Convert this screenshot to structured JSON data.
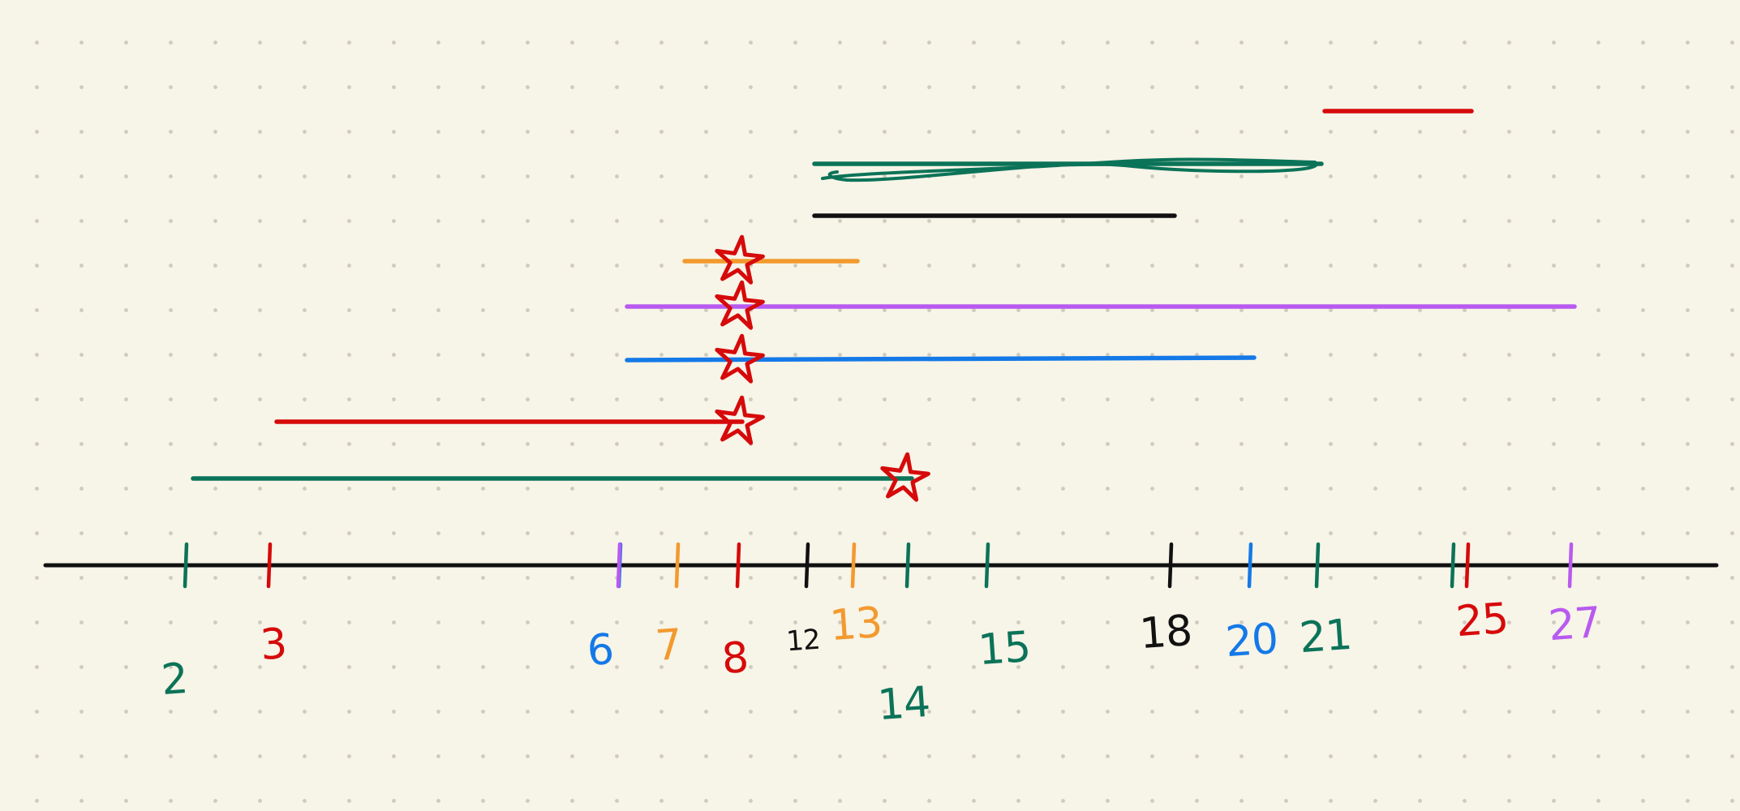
{
  "palette": {
    "green": "#0b7358",
    "red": "#d60a0a",
    "purple": "#b85af0",
    "orange": "#f29a2e",
    "blue": "#1479e8",
    "black": "#111111",
    "background": "#f7f4e8"
  },
  "number_line": {
    "ticks": [
      {
        "value": 2,
        "label": "2",
        "color": "green"
      },
      {
        "value": 3,
        "label": "3",
        "color": "red"
      },
      {
        "value": 6,
        "label": "6",
        "color": "blue"
      },
      {
        "value": 6,
        "label": "",
        "color": "purple"
      },
      {
        "value": 7,
        "label": "7",
        "color": "orange"
      },
      {
        "value": 8,
        "label": "8",
        "color": "red"
      },
      {
        "value": 12,
        "label": "12",
        "color": "black"
      },
      {
        "value": 13,
        "label": "13",
        "color": "orange"
      },
      {
        "value": 14,
        "label": "14",
        "color": "green"
      },
      {
        "value": 15,
        "label": "15",
        "color": "green"
      },
      {
        "value": 18,
        "label": "18",
        "color": "black"
      },
      {
        "value": 20,
        "label": "20",
        "color": "blue"
      },
      {
        "value": 21,
        "label": "21",
        "color": "green"
      },
      {
        "value": 25,
        "label": "25",
        "color": "red"
      },
      {
        "value": 25,
        "label": "",
        "color": "green"
      },
      {
        "value": 27,
        "label": "27",
        "color": "purple"
      }
    ]
  },
  "intervals": [
    {
      "start": 2,
      "end": 14,
      "color": "green",
      "star_at": 14
    },
    {
      "start": 3,
      "end": 8,
      "color": "red",
      "star_at": 8
    },
    {
      "start": 6,
      "end": 20,
      "color": "blue",
      "star_at": 8
    },
    {
      "start": 6,
      "end": 27,
      "color": "purple",
      "star_at": 8
    },
    {
      "start": 7,
      "end": 13,
      "color": "orange",
      "star_at": 8
    },
    {
      "start": 12,
      "end": 18,
      "color": "black",
      "star_at": null
    },
    {
      "start": 12,
      "end": 21,
      "color": "green",
      "star_at": null,
      "scribbled": true
    },
    {
      "start": 21,
      "end": 25,
      "color": "red",
      "star_at": null
    }
  ]
}
